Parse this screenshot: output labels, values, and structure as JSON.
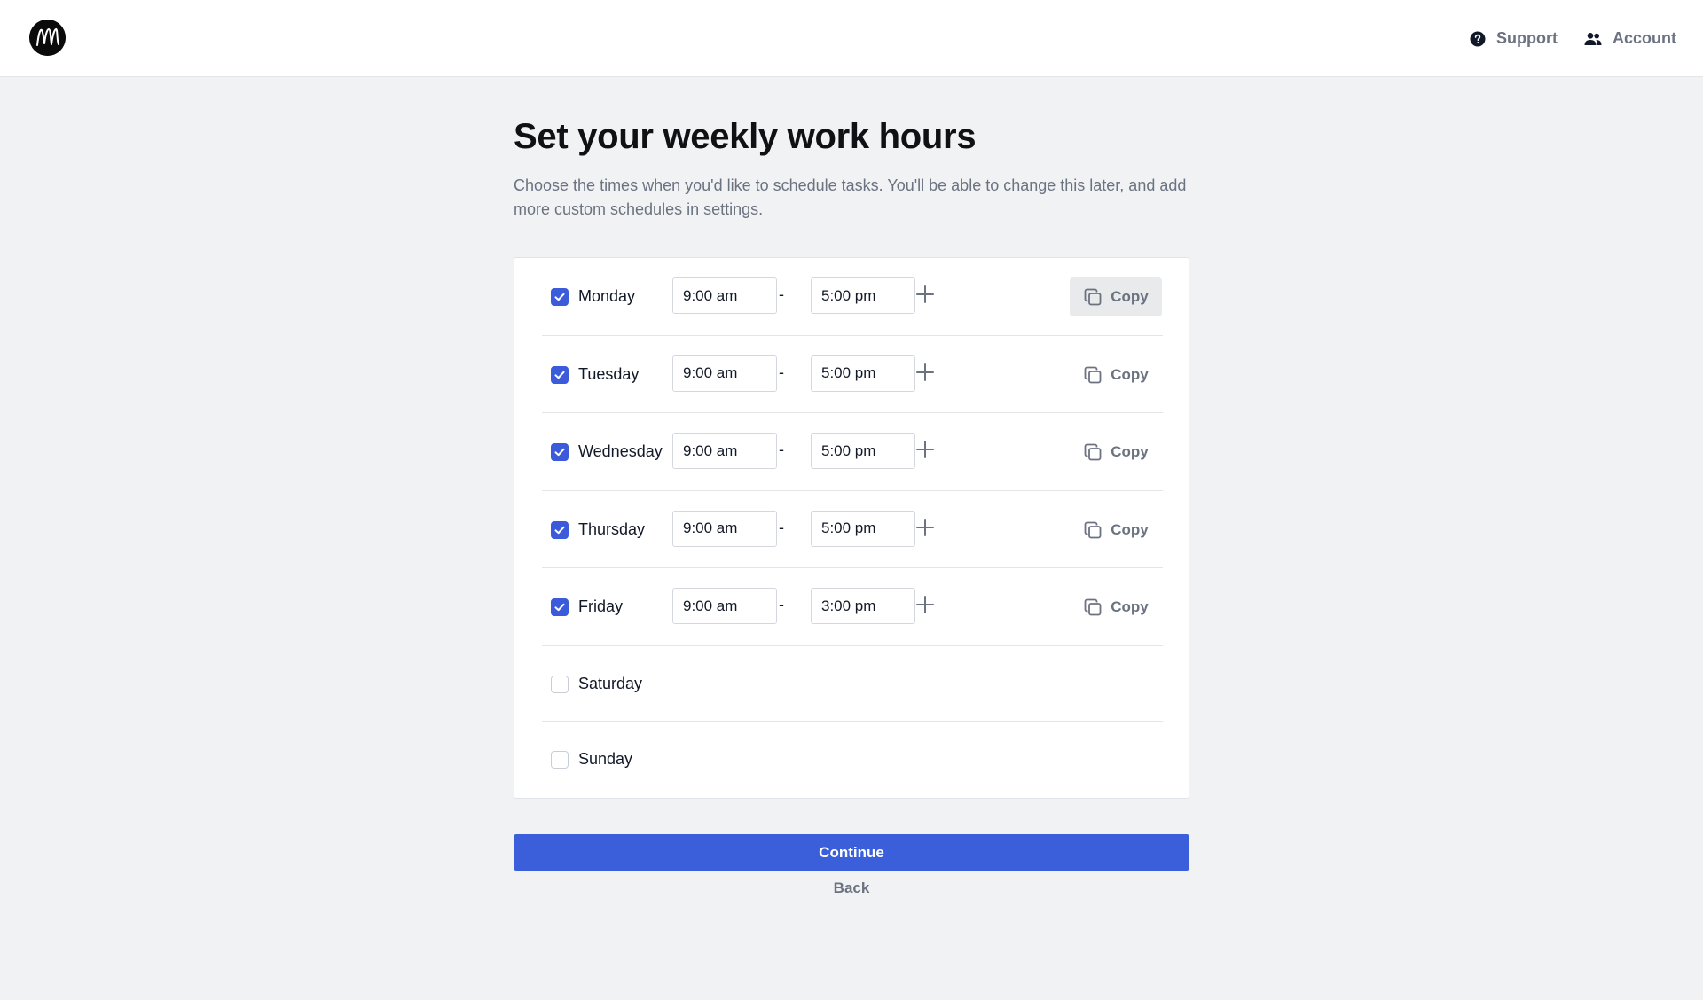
{
  "header": {
    "support_label": "Support",
    "account_label": "Account"
  },
  "page": {
    "title": "Set your weekly work hours",
    "description": "Choose the times when you'd like to schedule tasks. You'll be able to change this later, and add more custom schedules in settings."
  },
  "schedule": {
    "copy_label": "Copy",
    "separator": "-",
    "days": [
      {
        "name": "Monday",
        "enabled": true,
        "start": "9:00 am",
        "end": "5:00 pm"
      },
      {
        "name": "Tuesday",
        "enabled": true,
        "start": "9:00 am",
        "end": "5:00 pm"
      },
      {
        "name": "Wednesday",
        "enabled": true,
        "start": "9:00 am",
        "end": "5:00 pm"
      },
      {
        "name": "Thursday",
        "enabled": true,
        "start": "9:00 am",
        "end": "5:00 pm"
      },
      {
        "name": "Friday",
        "enabled": true,
        "start": "9:00 am",
        "end": "3:00 pm"
      },
      {
        "name": "Saturday",
        "enabled": false
      },
      {
        "name": "Sunday",
        "enabled": false
      }
    ]
  },
  "actions": {
    "continue_label": "Continue",
    "back_label": "Back"
  },
  "colors": {
    "accent": "#3b5bdb",
    "background": "#f1f2f4",
    "muted_text": "#6b7280"
  },
  "icons": {
    "support": "question-circle-icon",
    "account": "users-icon",
    "copy": "copy-icon",
    "add": "plus-icon",
    "check": "check-icon"
  }
}
